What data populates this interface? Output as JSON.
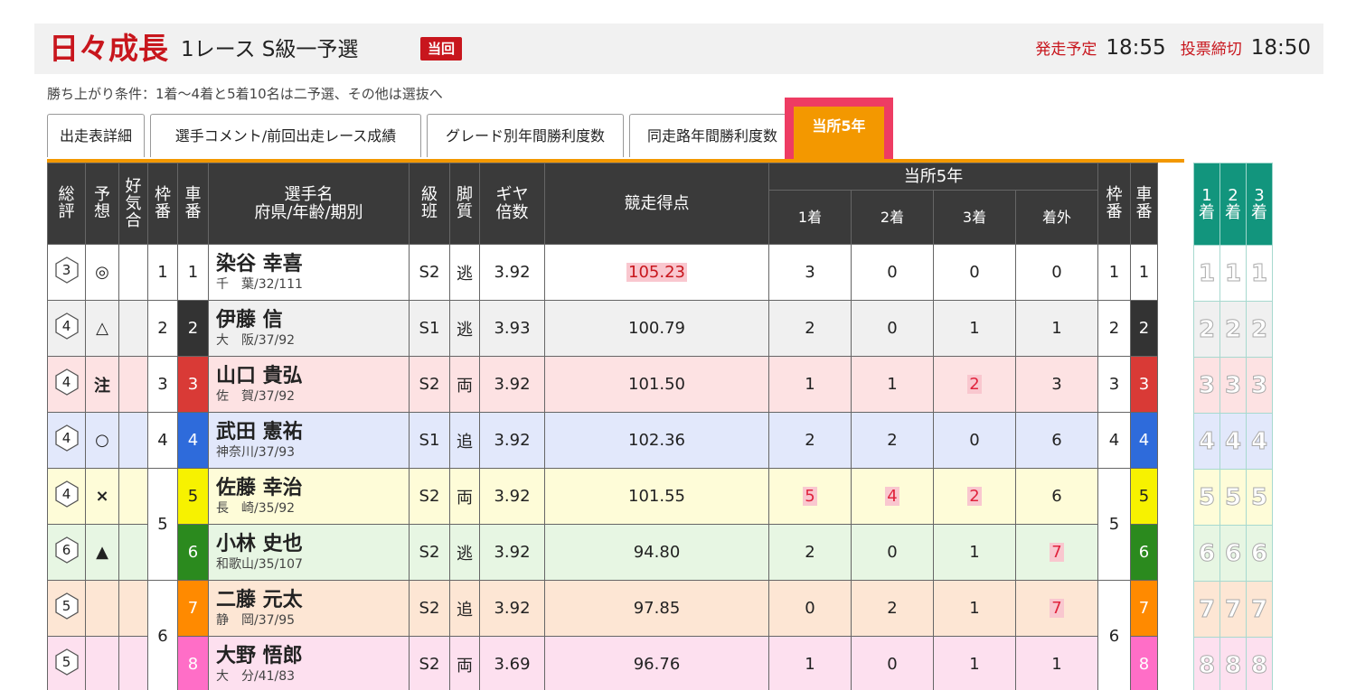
{
  "header": {
    "race_name": "日々成長",
    "race_title": "1レース S級一予選",
    "badge": "当回",
    "start_label": "発走予定",
    "start_time": "18:55",
    "close_label": "投票締切",
    "close_time": "18:50"
  },
  "condition": "勝ち上がり条件：1着〜4着と5着10名は二予選、その他は選抜へ",
  "tabs": [
    {
      "label": "出走表詳細"
    },
    {
      "label": "選手コメント/前回出走レース成績"
    },
    {
      "label": "グレード別年間勝利度数"
    },
    {
      "label": "同走路年間勝利度数"
    },
    {
      "label": "当所5年"
    }
  ],
  "table_header": {
    "soh": "総評",
    "yoso": "予想",
    "koki": "好気合",
    "waku": "枠番",
    "sha": "車番",
    "player": "選手名",
    "player_sub": "府県/年齢/期別",
    "kyu": "級班",
    "kyaku": "脚質",
    "gear": "ギヤ倍数",
    "score": "競走得点",
    "group": "当所5年",
    "g1": "1着",
    "g2": "2着",
    "g3": "3着",
    "gx": "着外",
    "waku2": "枠番",
    "sha2": "車番"
  },
  "side_header": [
    "1着",
    "2着",
    "3着"
  ],
  "colors": {
    "frame": [
      "#ffffff",
      "#333333",
      "#d93a36",
      "#2e6bdb",
      "#f7f200",
      "#2b8a1e",
      "#ff8a00",
      "#ff6ec7"
    ],
    "row_bg": [
      "#ffffff",
      "#f0f0f0",
      "#fde2e3",
      "#e2e8fb",
      "#fefcd8",
      "#e7f6e3",
      "#fde6d4",
      "#fde0ef"
    ]
  },
  "rows": [
    {
      "soh": "3",
      "yoso": "◎",
      "waku": "1",
      "sha": "1",
      "name": "染谷 幸喜",
      "pref": "千　葉/32/111",
      "kyu": "S2",
      "kyaku": "逃",
      "gear": "3.92",
      "score": "105.23",
      "g1": "3",
      "g2": "0",
      "g3": "0",
      "gx": "0"
    },
    {
      "soh": "4",
      "yoso": "△",
      "waku": "2",
      "sha": "2",
      "name": "伊藤 信",
      "pref": "大　阪/37/92",
      "kyu": "S1",
      "kyaku": "逃",
      "gear": "3.93",
      "score": "100.79",
      "g1": "2",
      "g2": "0",
      "g3": "1",
      "gx": "1"
    },
    {
      "soh": "4",
      "yoso": "注",
      "waku": "3",
      "sha": "3",
      "name": "山口 貴弘",
      "pref": "佐　賀/37/92",
      "kyu": "S2",
      "kyaku": "両",
      "gear": "3.92",
      "score": "101.50",
      "g1": "1",
      "g2": "1",
      "g3": "2",
      "gx": "3"
    },
    {
      "soh": "4",
      "yoso": "○",
      "waku": "4",
      "sha": "4",
      "name": "武田 憲祐",
      "pref": "神奈川/37/93",
      "kyu": "S1",
      "kyaku": "追",
      "gear": "3.92",
      "score": "102.36",
      "g1": "2",
      "g2": "2",
      "g3": "0",
      "gx": "6"
    },
    {
      "soh": "4",
      "yoso": "×",
      "waku": "5",
      "sha": "5",
      "name": "佐藤 幸治",
      "pref": "長　崎/35/92",
      "kyu": "S2",
      "kyaku": "両",
      "gear": "3.92",
      "score": "101.55",
      "g1": "5",
      "g2": "4",
      "g3": "2",
      "gx": "6"
    },
    {
      "soh": "6",
      "yoso": "▲",
      "waku": "5",
      "sha": "6",
      "name": "小林 史也",
      "pref": "和歌山/35/107",
      "kyu": "S2",
      "kyaku": "逃",
      "gear": "3.92",
      "score": "94.80",
      "g1": "2",
      "g2": "0",
      "g3": "1",
      "gx": "7"
    },
    {
      "soh": "5",
      "yoso": "",
      "waku": "6",
      "sha": "7",
      "name": "二藤 元太",
      "pref": "静　岡/37/95",
      "kyu": "S2",
      "kyaku": "追",
      "gear": "3.92",
      "score": "97.85",
      "g1": "0",
      "g2": "2",
      "g3": "1",
      "gx": "7"
    },
    {
      "soh": "5",
      "yoso": "",
      "waku": "6",
      "sha": "8",
      "name": "大野 悟郎",
      "pref": "大　分/41/83",
      "kyu": "S2",
      "kyaku": "両",
      "gear": "3.69",
      "score": "96.76",
      "g1": "1",
      "g2": "0",
      "g3": "1",
      "gx": "1"
    }
  ]
}
